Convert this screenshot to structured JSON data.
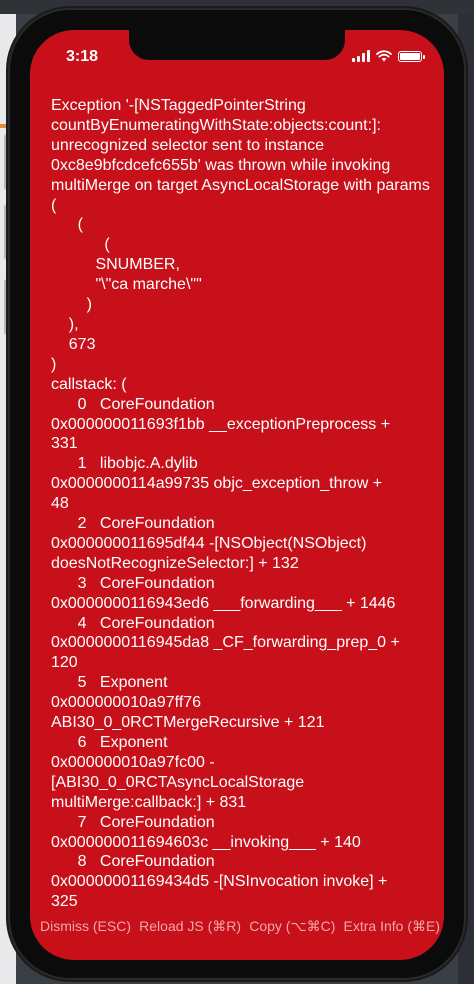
{
  "status_bar": {
    "time": "3:18"
  },
  "error": {
    "text": "Exception '-[NSTaggedPointerString countByEnumeratingWithState:objects:count:]: unrecognized selector sent to instance 0xc8e9bfcdcefc655b' was thrown while invoking multiMerge on target AsyncLocalStorage with params (\n      (\n            (\n          SNUMBER,\n          \"\\\"ca marche\\\"\"\n        )\n    ),\n    673\n)\ncallstack: (\n      0   CoreFoundation\n0x000000011693f1bb __exceptionPreprocess +\n331\n      1   libobjc.A.dylib\n0x0000000114a99735 objc_exception_throw +\n48\n      2   CoreFoundation\n0x000000011695df44 -[NSObject(NSObject)\ndoesNotRecognizeSelector:] + 132\n      3   CoreFoundation\n0x0000000116943ed6 ___forwarding___ + 1446\n      4   CoreFoundation\n0x0000000116945da8 _CF_forwarding_prep_0 +\n120\n      5   Exponent\n0x000000010a97ff76\nABI30_0_0RCTMergeRecursive + 121\n      6   Exponent\n0x000000010a97fc00 -\n[ABI30_0_0RCTAsyncLocalStorage\nmultiMerge:callback:] + 831\n      7   CoreFoundation\n0x000000011694603c __invoking___ + 140\n      8   CoreFoundation\n0x00000001169434d5 -[NSInvocation invoke] +\n325"
  },
  "actions": {
    "dismiss": "Dismiss (ESC)",
    "reload": "Reload JS (⌘R)",
    "copy": "Copy (⌥⌘C)",
    "extra": "Extra Info (⌘E)"
  },
  "colors": {
    "screen_background": "#c7101a",
    "text": "#ffffff",
    "action_text": "#f1a7a8"
  },
  "icons": [
    "signal-icon",
    "wifi-icon",
    "battery-icon"
  ]
}
